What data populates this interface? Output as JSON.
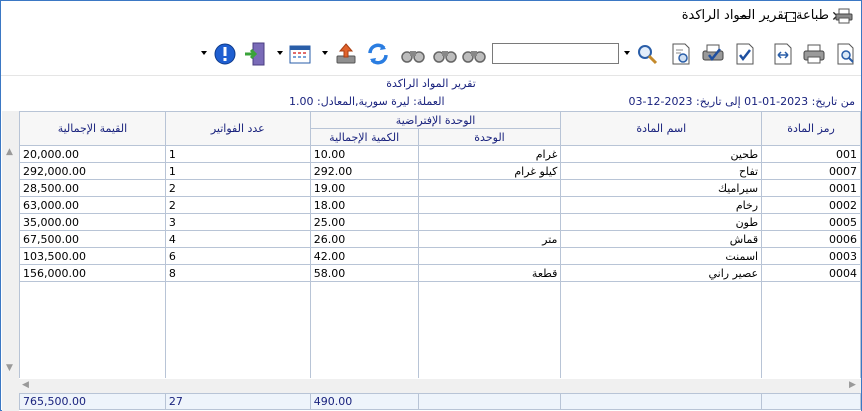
{
  "window": {
    "title": "طباعة: تقرير المواد الراكدة",
    "title_icon": "printer-icon",
    "minimize_glyph": "─",
    "maximize_glyph": "☐",
    "close_glyph": "✕"
  },
  "toolbar": {
    "search_value": "",
    "buttons": [
      "print-preview-icon",
      "print-icon",
      "fit-width-icon",
      "check-doc-icon",
      "print-check-icon",
      "print-settings-icon",
      "zoom-icon",
      "binoculars-icon",
      "binoculars-icon",
      "refresh-icon",
      "export-icon",
      "calendar-icon",
      "exit-icon",
      "info-icon"
    ]
  },
  "report": {
    "title": "تقرير المواد الراكدة",
    "date_range": "من تاريخ: 2023-01-01 إلى تاريخ: 2023-12-03",
    "currency": "العملة: ليرة سورية,المعادل: 1.00"
  },
  "table": {
    "headers": {
      "code": "رمز المادة",
      "name": "اسم المادة",
      "default_unit": "الوحدة الإفتراضية",
      "unit": "الوحدة",
      "total_qty": "الكمية الإجمالية",
      "invoice_count": "عدد الفواتير",
      "total_value": "القيمة الإجمالية"
    },
    "rows": [
      {
        "code": "001",
        "name": "طحين",
        "unit": "غرام",
        "qty": "10.00",
        "invoices": "1",
        "value": "20,000.00"
      },
      {
        "code": "0007",
        "name": "تفاح",
        "unit": "كيلو غرام",
        "qty": "292.00",
        "invoices": "1",
        "value": "292,000.00"
      },
      {
        "code": "0001",
        "name": "سيراميك",
        "unit": "",
        "qty": "19.00",
        "invoices": "2",
        "value": "28,500.00"
      },
      {
        "code": "0002",
        "name": "رخام",
        "unit": "",
        "qty": "18.00",
        "invoices": "2",
        "value": "63,000.00"
      },
      {
        "code": "0005",
        "name": "طون",
        "unit": "",
        "qty": "25.00",
        "invoices": "3",
        "value": "35,000.00"
      },
      {
        "code": "0006",
        "name": "قماش",
        "unit": "متر",
        "qty": "26.00",
        "invoices": "4",
        "value": "67,500.00"
      },
      {
        "code": "0003",
        "name": "اسمنت",
        "unit": "",
        "qty": "42.00",
        "invoices": "6",
        "value": "103,500.00"
      },
      {
        "code": "0004",
        "name": "عصير راني",
        "unit": "قطعة",
        "qty": "58.00",
        "invoices": "8",
        "value": "156,000.00"
      }
    ],
    "totals": {
      "qty": "490.00",
      "invoices": "27",
      "value": "765,500.00"
    }
  },
  "colors": {
    "header_text": "#1a237e",
    "grid_border": "#b8c4d6",
    "totals_bg": "#eef4fb"
  }
}
